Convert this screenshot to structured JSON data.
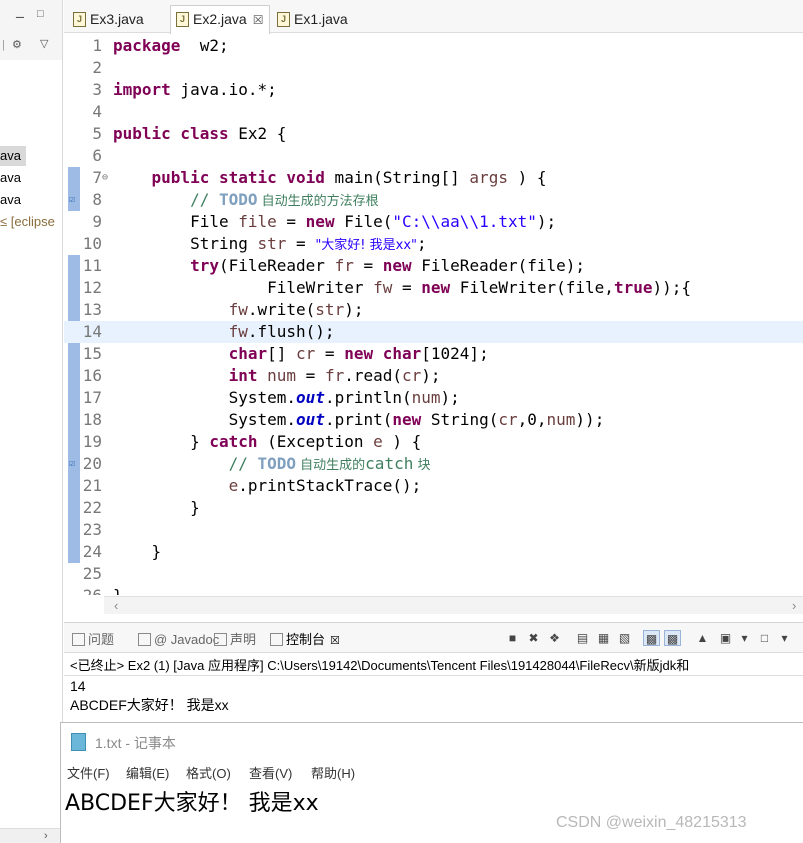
{
  "left_pane": {
    "items": [
      {
        "label": "ava",
        "selected": true
      },
      {
        "label": "ava",
        "selected": false
      },
      {
        "label": "ava",
        "selected": false
      },
      {
        "label": "≤ [eclipse",
        "selected": false
      }
    ]
  },
  "editor": {
    "tabs": [
      {
        "label": "Ex3.java",
        "active": false
      },
      {
        "label": "Ex2.java",
        "active": true,
        "close": "☒"
      },
      {
        "label": "Ex1.java",
        "active": false
      }
    ],
    "current_line": 14,
    "lines": [
      {
        "n": "1",
        "t": [
          [
            "kw",
            "package"
          ],
          [
            "",
            "  w2;"
          ]
        ]
      },
      {
        "n": "2",
        "t": []
      },
      {
        "n": "3",
        "t": [
          [
            "kw",
            "import"
          ],
          [
            "",
            " java.io.*;"
          ]
        ]
      },
      {
        "n": "4",
        "t": []
      },
      {
        "n": "5",
        "t": [
          [
            "kw",
            "public class"
          ],
          [
            "",
            " Ex2 {"
          ]
        ]
      },
      {
        "n": "6",
        "t": []
      },
      {
        "n": "7",
        "t": [
          [
            "",
            "    "
          ],
          [
            "kw",
            "public static void"
          ],
          [
            "",
            " main(String[] "
          ],
          [
            "var",
            "args"
          ],
          [
            "",
            " ) {"
          ]
        ]
      },
      {
        "n": "8",
        "t": [
          [
            "",
            "        "
          ],
          [
            "cmt",
            "// "
          ],
          [
            "todo",
            "TODO"
          ],
          [
            "cmt cjk",
            " 自动生成的方法存根"
          ]
        ]
      },
      {
        "n": "9",
        "t": [
          [
            "",
            "        File "
          ],
          [
            "var",
            "file"
          ],
          [
            "",
            " = "
          ],
          [
            "kw",
            "new"
          ],
          [
            "",
            " File("
          ],
          [
            "str",
            "\"C:\\\\aa\\\\1.txt\""
          ],
          [
            "",
            ");"
          ]
        ]
      },
      {
        "n": "10",
        "t": [
          [
            "",
            "        String "
          ],
          [
            "var",
            "str"
          ],
          [
            "",
            " = "
          ],
          [
            "str cjk",
            "\"大家好! 我是xx\""
          ],
          [
            "",
            ";"
          ]
        ]
      },
      {
        "n": "11",
        "t": [
          [
            "",
            "        "
          ],
          [
            "kw",
            "try"
          ],
          [
            "",
            "(FileReader "
          ],
          [
            "var",
            "fr"
          ],
          [
            "",
            " = "
          ],
          [
            "kw",
            "new"
          ],
          [
            "",
            " FileReader(file);"
          ]
        ]
      },
      {
        "n": "12",
        "t": [
          [
            "",
            "                FileWriter "
          ],
          [
            "var",
            "fw"
          ],
          [
            "",
            " = "
          ],
          [
            "kw",
            "new"
          ],
          [
            "",
            " FileWriter(file,"
          ],
          [
            "kw",
            "true"
          ],
          [
            "",
            "));{"
          ]
        ]
      },
      {
        "n": "13",
        "t": [
          [
            "",
            "            "
          ],
          [
            "var",
            "fw"
          ],
          [
            "",
            ".write("
          ],
          [
            "var",
            "str"
          ],
          [
            "",
            ");"
          ]
        ]
      },
      {
        "n": "14",
        "t": [
          [
            "",
            "            "
          ],
          [
            "var",
            "fw"
          ],
          [
            "",
            ".flush();"
          ]
        ]
      },
      {
        "n": "15",
        "t": [
          [
            "",
            "            "
          ],
          [
            "kw",
            "char"
          ],
          [
            "",
            "[] "
          ],
          [
            "var",
            "cr"
          ],
          [
            "",
            " = "
          ],
          [
            "kw",
            "new char"
          ],
          [
            "",
            "[1024];"
          ]
        ]
      },
      {
        "n": "16",
        "t": [
          [
            "",
            "            "
          ],
          [
            "kw",
            "int"
          ],
          [
            "",
            " "
          ],
          [
            "var",
            "num"
          ],
          [
            "",
            " = "
          ],
          [
            "var",
            "fr"
          ],
          [
            "",
            ".read("
          ],
          [
            "var",
            "cr"
          ],
          [
            "",
            ");"
          ]
        ]
      },
      {
        "n": "17",
        "t": [
          [
            "",
            "            System."
          ],
          [
            "fld",
            "out"
          ],
          [
            "",
            ".println("
          ],
          [
            "var",
            "num"
          ],
          [
            "",
            ");"
          ]
        ]
      },
      {
        "n": "18",
        "t": [
          [
            "",
            "            System."
          ],
          [
            "fld",
            "out"
          ],
          [
            "",
            ".print("
          ],
          [
            "kw",
            "new"
          ],
          [
            "",
            " String("
          ],
          [
            "var",
            "cr"
          ],
          [
            "",
            ",0,"
          ],
          [
            "var",
            "num"
          ],
          [
            "",
            "));"
          ]
        ]
      },
      {
        "n": "19",
        "t": [
          [
            "",
            "        } "
          ],
          [
            "kw",
            "catch"
          ],
          [
            "",
            " (Exception "
          ],
          [
            "var",
            "e"
          ],
          [
            "",
            " ) {"
          ]
        ]
      },
      {
        "n": "20",
        "t": [
          [
            "",
            "            "
          ],
          [
            "cmt",
            "// "
          ],
          [
            "todo",
            "TODO"
          ],
          [
            "cmt cjk",
            " 自动生成的"
          ],
          [
            "cmt",
            "catch"
          ],
          [
            "cmt cjk",
            " 块"
          ]
        ]
      },
      {
        "n": "21",
        "t": [
          [
            "",
            "            "
          ],
          [
            "var",
            "e"
          ],
          [
            "",
            ".printStackTrace();"
          ]
        ]
      },
      {
        "n": "22",
        "t": [
          [
            "",
            "        }"
          ]
        ]
      },
      {
        "n": "23",
        "t": []
      },
      {
        "n": "24",
        "t": [
          [
            "",
            "    }"
          ]
        ]
      },
      {
        "n": "25",
        "t": []
      },
      {
        "n": "26",
        "t": [
          [
            "",
            "}"
          ]
        ]
      }
    ]
  },
  "console": {
    "tabs": [
      {
        "label": "问题",
        "active": false
      },
      {
        "label": "@ Javadoc",
        "active": false
      },
      {
        "label": "声明",
        "active": false
      },
      {
        "label": "控制台",
        "active": true,
        "close": "☒"
      }
    ],
    "status": "<已终止> Ex2 (1)  [Java 应用程序] C:\\Users\\19142\\Documents\\Tencent Files\\191428044\\FileRecv\\新版jdk和",
    "output": [
      "14",
      "ABCDEF大家好！ 我是xx"
    ]
  },
  "notepad": {
    "title": "1.txt - 记事本",
    "menu": [
      "文件(F)",
      "编辑(E)",
      "格式(O)",
      "查看(V)",
      "帮助(H)"
    ],
    "content": "ABCDEF大家好！ 我是xx"
  },
  "watermark": "CSDN @weixin_48215313"
}
